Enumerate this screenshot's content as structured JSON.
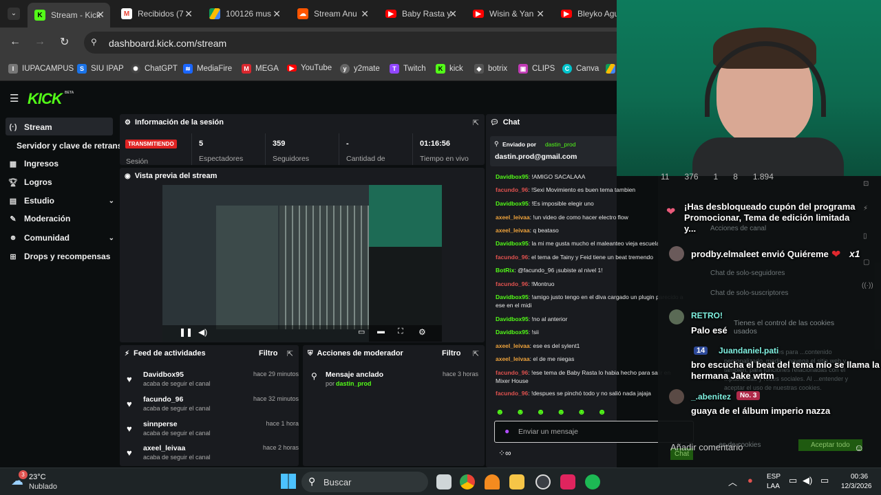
{
  "browser": {
    "tabs": [
      {
        "label": "Stream - Kick",
        "icon": "kick-icon",
        "color": "#53fc18"
      },
      {
        "label": "Recibidos (7",
        "icon": "gmail-icon",
        "color": "#ea4335"
      },
      {
        "label": "100126 mus",
        "icon": "drive-icon",
        "color": "#fbbc04"
      },
      {
        "label": "Stream Anu",
        "icon": "soundcloud-icon",
        "color": "#ff5500"
      },
      {
        "label": "Baby Rasta y",
        "icon": "youtube-icon",
        "color": "#ff0000"
      },
      {
        "label": "Wisin & Yan",
        "icon": "youtube-icon",
        "color": "#ff0000"
      },
      {
        "label": "Bleyko Agui",
        "icon": "youtube-icon",
        "color": "#ff0000"
      }
    ],
    "url": "dashboard.kick.com/stream",
    "bookmarks": [
      {
        "label": "IUPACAMPUS",
        "icon": "iupa-icon",
        "color": "#888"
      },
      {
        "label": "SIU IPAP",
        "icon": "siu-icon",
        "color": "#1a73e8"
      },
      {
        "label": "ChatGPT",
        "icon": "chatgpt-icon",
        "color": "#444"
      },
      {
        "label": "MediaFire",
        "icon": "mediafire-icon",
        "color": "#1a66ff"
      },
      {
        "label": "MEGA",
        "icon": "mega-icon",
        "color": "#d9272e"
      },
      {
        "label": "YouTube",
        "icon": "youtube-icon",
        "color": "#ff0000"
      },
      {
        "label": "y2mate",
        "icon": "y2mate-icon",
        "color": "#777"
      },
      {
        "label": "Twitch",
        "icon": "twitch-icon",
        "color": "#9146ff"
      },
      {
        "label": "kick",
        "icon": "kick-icon",
        "color": "#53fc18"
      },
      {
        "label": "botrix",
        "icon": "botrix-icon",
        "color": "#555"
      },
      {
        "label": "CLIPS",
        "icon": "clips-icon",
        "color": "#c13ab5"
      },
      {
        "label": "Canva",
        "icon": "canva-icon",
        "color": "#00c4cc"
      }
    ]
  },
  "kick": {
    "logo": "KICK",
    "logo_beta": "BETA",
    "accent": "#53fc18",
    "sidebar": [
      {
        "label": "Stream",
        "icon": "stream-icon"
      },
      {
        "label": "Servidor y clave de retransm",
        "icon": ""
      },
      {
        "label": "Ingresos",
        "icon": "income-icon"
      },
      {
        "label": "Logros",
        "icon": "trophy-icon"
      },
      {
        "label": "Estudio",
        "icon": "studio-icon"
      },
      {
        "label": "Moderación",
        "icon": "wrench-icon"
      },
      {
        "label": "Comunidad",
        "icon": "community-icon"
      },
      {
        "label": "Drops y recompensas",
        "icon": "drops-icon"
      }
    ],
    "session": {
      "title": "Información de la sesión",
      "badge": "TRANSMITIENDO",
      "session_label": "Sesión",
      "stats": [
        {
          "value": "5",
          "label": "Espectadores"
        },
        {
          "value": "359",
          "label": "Seguidores"
        },
        {
          "value": "-",
          "label": "Cantidad de"
        },
        {
          "value": "01:16:56",
          "label": "Tiempo en vivo"
        }
      ]
    },
    "preview": {
      "title": "Vista previa del stream"
    },
    "feed": {
      "title": "Feed de actividades",
      "filter": "Filtro",
      "items": [
        {
          "user": "Davidbox95",
          "action": "acaba de seguir el canal",
          "time": "hace 29 minutos"
        },
        {
          "user": "facundo_96",
          "action": "acaba de seguir el canal",
          "time": "hace 32 minutos"
        },
        {
          "user": "sinnperse",
          "action": "acaba de seguir el canal",
          "time": "hace 1 hora"
        },
        {
          "user": "axeel_leivaa",
          "action": "acaba de seguir el canal",
          "time": "hace 2 horas"
        }
      ]
    },
    "mod": {
      "title": "Acciones de moderador",
      "filter": "Filtro",
      "item": {
        "action": "Mensaje anclado",
        "by": "por",
        "user": "dastin_prod",
        "time": "hace 3 horas"
      }
    },
    "chat": {
      "title": "Chat",
      "pinned_by": "Enviado por",
      "pinned_user": "dastin_prod",
      "pinned_text": "dastin.prod@gmail.com",
      "input_placeholder": "Enviar un mensaje",
      "messages": [
        {
          "user": "Davidbox95",
          "text": ": !AMIGO SACALAAA",
          "color": "#53fc18"
        },
        {
          "user": "facundo_96",
          "text": ": !Sexi Movimiento es buen tema tambien",
          "color": "#e0524f"
        },
        {
          "user": "Davidbox95",
          "text": ": !Es imposible elegir uno",
          "color": "#53fc18"
        },
        {
          "user": "axeel_leivaa",
          "text": ": !un video de como hacer electro flow",
          "color": "#f0a43c"
        },
        {
          "user": "axeel_leivaa",
          "text": ": q beataso",
          "color": "#f0a43c"
        },
        {
          "user": "Davidbox95",
          "text": ": la mi me gusta mucho el maleanteo vieja escuela",
          "color": "#53fc18"
        },
        {
          "user": "facundo_96",
          "text": ": el tema de Tainy y Feid tiene un beat tremendo",
          "color": "#e0524f"
        },
        {
          "user": "BotRix",
          "text": ": @facundo_96 ¡subiste al nivel 1!",
          "color": "#53fc18"
        },
        {
          "user": "facundo_96",
          "text": ": !Montruo",
          "color": "#e0524f"
        },
        {
          "user": "Davidbox95",
          "text": ": !amigo justo tengo en el diva cargado un plugin parecido a ese en el midi",
          "color": "#53fc18"
        },
        {
          "user": "Davidbox95",
          "text": ": !no al anterior",
          "color": "#53fc18"
        },
        {
          "user": "Davidbox95",
          "text": ": !sii",
          "color": "#53fc18"
        },
        {
          "user": "axeel_leivaa",
          "text": ": ese es del sylent1",
          "color": "#f0a43c"
        },
        {
          "user": "axeel_leivaa",
          "text": ": el de me niegas",
          "color": "#f0a43c"
        },
        {
          "user": "facundo_96",
          "text": ": !ese tema de Baby Rasta lo habia hecho para salir en Mixer House",
          "color": "#e0524f"
        },
        {
          "user": "facundo_96",
          "text": ": !despues se pinchó todo y no salió nada jajaja",
          "color": "#e0524f"
        }
      ]
    }
  },
  "overlay": {
    "stats": [
      "11",
      "376",
      "1",
      "8",
      "1.894"
    ],
    "alerts": [
      {
        "text": "¡Has desbloqueado cupón del programa Promocionar, Tema de edición limitada y..."
      },
      {
        "text": "prodby.elmaleet envió Quiéreme",
        "count": "x1"
      }
    ],
    "chat": [
      {
        "user": "RETRO!",
        "text": "Palo esé"
      },
      {
        "badge": "14",
        "user": "Juandaniel.pati",
        "text": "bro escucha el beat del tema mío se llama la hermana Jake wttm"
      },
      {
        "user": "_.abenitez",
        "badge": "No. 3",
        "text": "guaya de el álbum imperio nazza"
      }
    ],
    "comment_placeholder": "Añadir comentario",
    "ghost": {
      "actions": "Acciones de canal",
      "followers_chat": "Chat de solo-seguidores",
      "subs_chat": "Chat de solo-suscriptores",
      "cookies_title": "Tienes el control de las cookies usados",
      "cookies_body": "...cios utilizan cookies para ...contenido personalizado, medir ...navega el sitio web y, también, para funciones relacionadas con el ...publicidad y redes sociales. Al ...entender y aceptar el uso de nuestras cookies.",
      "cookies_btn1": "...es de cookies",
      "cookies_btn2": "Aceptar todo",
      "chat_btn": "Chat"
    }
  },
  "taskbar": {
    "weather_temp": "23°C",
    "weather_desc": "Nublado",
    "weather_badge": "3",
    "search": "Buscar",
    "lang1": "ESP",
    "lang2": "LAA",
    "time": "00:36",
    "date": "12/3/2026"
  }
}
